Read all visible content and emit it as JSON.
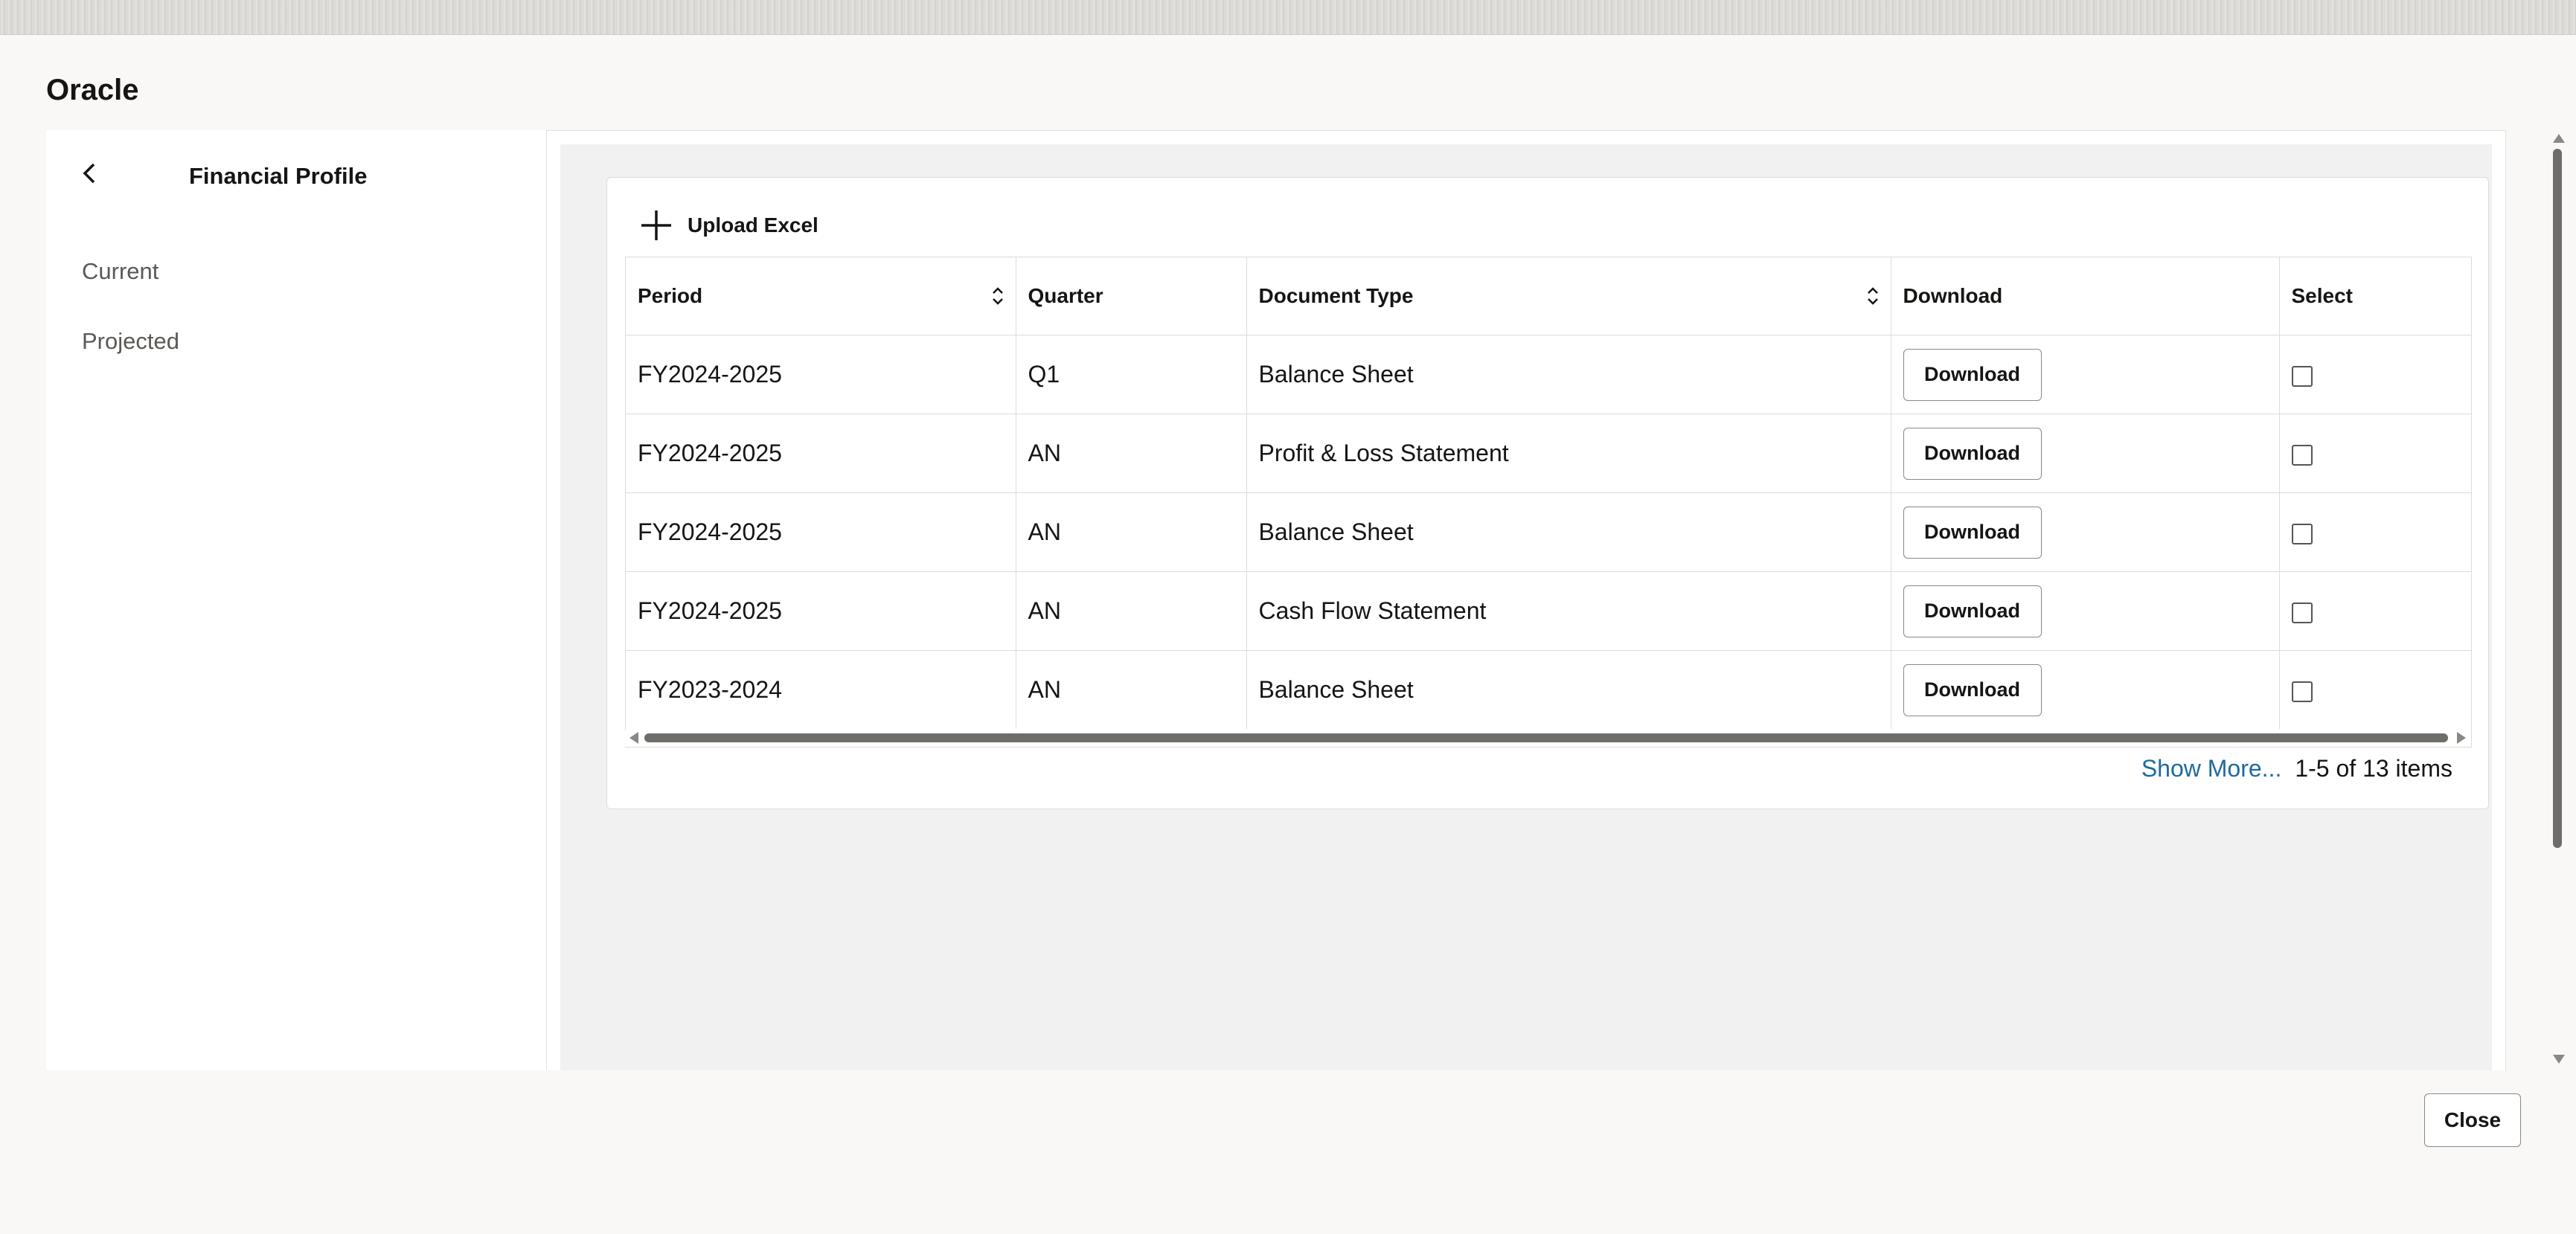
{
  "dialog": {
    "title": "Oracle",
    "close_label": "Close"
  },
  "sidebar": {
    "back_icon": "chevron-left-icon",
    "title": "Financial Profile",
    "items": [
      {
        "label": "Current"
      },
      {
        "label": "Projected"
      }
    ]
  },
  "toolbar": {
    "upload_icon": "plus-icon",
    "upload_label": "Upload Excel"
  },
  "table": {
    "columns": [
      {
        "label": "Period",
        "sortable": true
      },
      {
        "label": "Quarter",
        "sortable": false
      },
      {
        "label": "Document Type",
        "sortable": true
      },
      {
        "label": "Download",
        "sortable": false
      },
      {
        "label": "Select",
        "sortable": false
      }
    ],
    "rows": [
      {
        "period": "FY2024-2025",
        "quarter": "Q1",
        "document_type": "Balance Sheet",
        "download_label": "Download",
        "selected": false
      },
      {
        "period": "FY2024-2025",
        "quarter": "AN",
        "document_type": "Profit & Loss Statement",
        "download_label": "Download",
        "selected": false
      },
      {
        "period": "FY2024-2025",
        "quarter": "AN",
        "document_type": "Balance Sheet",
        "download_label": "Download",
        "selected": false
      },
      {
        "period": "FY2024-2025",
        "quarter": "AN",
        "document_type": "Cash Flow Statement",
        "download_label": "Download",
        "selected": false
      },
      {
        "period": "FY2023-2024",
        "quarter": "AN",
        "document_type": "Balance Sheet",
        "download_label": "Download",
        "selected": false
      }
    ]
  },
  "pagination": {
    "show_more_label": "Show More...",
    "range_label": "1-5 of 13 items"
  },
  "colors": {
    "link": "#1e6aa0",
    "dialog_background": "#f9f8f6",
    "panel_background": "#f1f1f1"
  }
}
